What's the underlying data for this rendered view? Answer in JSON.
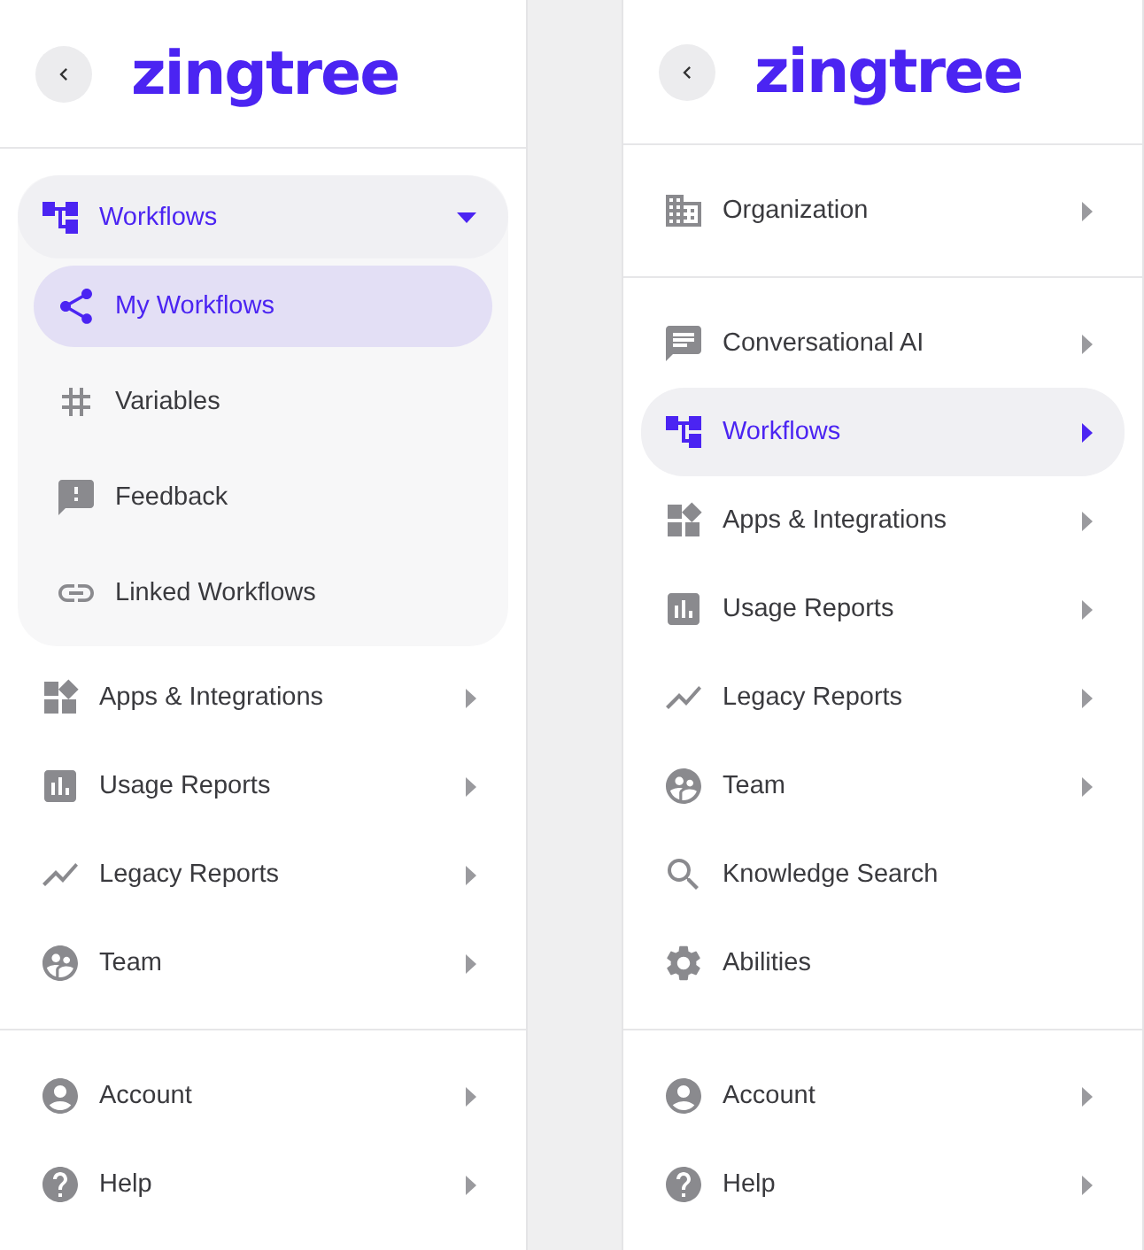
{
  "panels": [
    {
      "logo": "zingtree",
      "sections": [
        {
          "items": [
            {
              "kind": "sitemap",
              "label": "Workflows",
              "expanded": true,
              "selected": true,
              "children": [
                {
                  "kind": "share",
                  "label": "My Workflows",
                  "selected": true
                },
                {
                  "kind": "hash",
                  "label": "Variables",
                  "selected": false
                },
                {
                  "kind": "feedback",
                  "label": "Feedback",
                  "selected": false
                },
                {
                  "kind": "link",
                  "label": "Linked Workflows",
                  "selected": false
                }
              ]
            },
            {
              "kind": "widgets",
              "label": "Apps & Integrations",
              "expanded": false,
              "selected": false
            },
            {
              "kind": "barchart",
              "label": "Usage Reports",
              "expanded": false,
              "selected": false
            },
            {
              "kind": "linechart",
              "label": "Legacy Reports",
              "expanded": false,
              "selected": false
            },
            {
              "kind": "people",
              "label": "Team",
              "expanded": false,
              "selected": false
            }
          ]
        },
        {
          "items": [
            {
              "kind": "account",
              "label": "Account",
              "expanded": false,
              "selected": false
            },
            {
              "kind": "help",
              "label": "Help",
              "expanded": false,
              "selected": false
            }
          ]
        }
      ]
    },
    {
      "logo": "zingtree",
      "sections": [
        {
          "items": [
            {
              "kind": "building",
              "label": "Organization",
              "expanded": false,
              "selected": false
            }
          ]
        },
        {
          "items": [
            {
              "kind": "chat",
              "label": "Conversational AI",
              "expanded": false,
              "selected": false
            },
            {
              "kind": "sitemap",
              "label": "Workflows",
              "expanded": false,
              "selected": true
            },
            {
              "kind": "widgets",
              "label": "Apps & Integrations",
              "expanded": false,
              "selected": false
            },
            {
              "kind": "barchart",
              "label": "Usage Reports",
              "expanded": false,
              "selected": false
            },
            {
              "kind": "linechart",
              "label": "Legacy Reports",
              "expanded": false,
              "selected": false
            },
            {
              "kind": "people",
              "label": "Team",
              "expanded": false,
              "selected": false
            },
            {
              "kind": "search",
              "label": "Knowledge Search",
              "selected": false
            },
            {
              "kind": "settings",
              "label": "Abilities",
              "selected": false
            }
          ]
        },
        {
          "items": [
            {
              "kind": "account",
              "label": "Account",
              "expanded": false,
              "selected": false
            },
            {
              "kind": "help",
              "label": "Help",
              "expanded": false,
              "selected": false
            }
          ]
        }
      ]
    }
  ]
}
